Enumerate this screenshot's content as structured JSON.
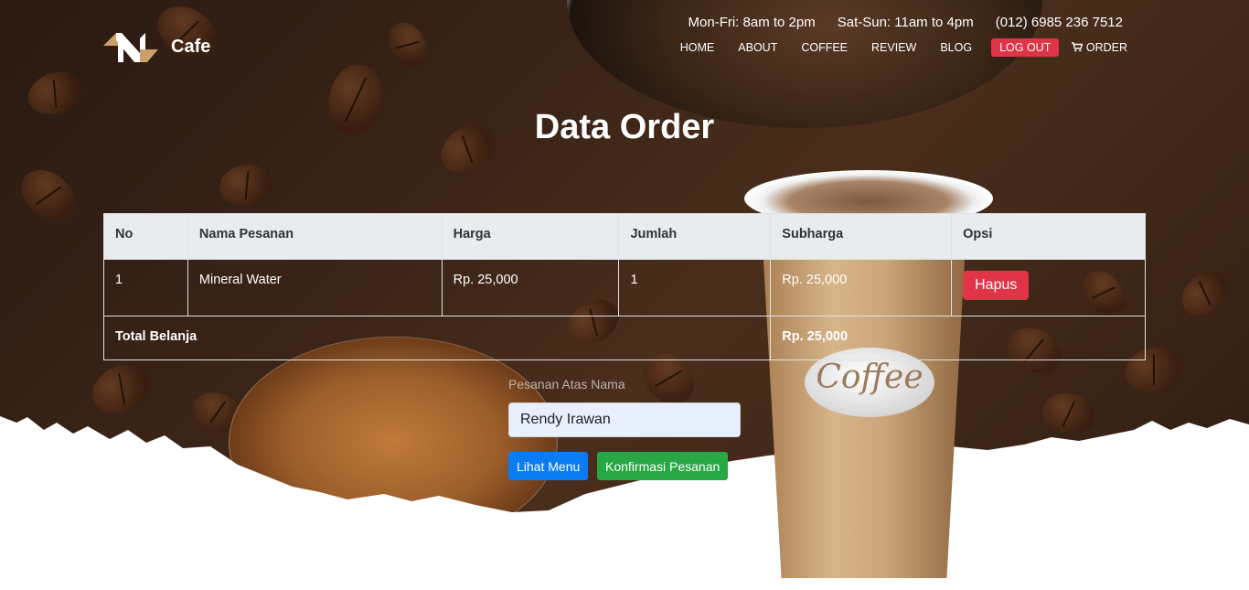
{
  "brand": {
    "name": "Cafe"
  },
  "header": {
    "info": [
      "Mon-Fri: 8am to 2pm",
      "Sat-Sun: 11am to 4pm",
      "(012) 6985 236 7512"
    ],
    "nav": [
      "HOME",
      "ABOUT",
      "COFFEE",
      "REVIEW",
      "BLOG"
    ],
    "logout": "LOG OUT",
    "order": "ORDER"
  },
  "page": {
    "title": "Data Order"
  },
  "table": {
    "headers": [
      "No",
      "Nama Pesanan",
      "Harga",
      "Jumlah",
      "Subharga",
      "Opsi"
    ],
    "rows": [
      {
        "no": "1",
        "nama": "Mineral Water",
        "harga": "Rp. 25,000",
        "jumlah": "1",
        "subharga": "Rp. 25,000",
        "action": "Hapus"
      }
    ],
    "total_label": "Total Belanja",
    "total_value": "Rp. 25,000"
  },
  "form": {
    "label": "Pesanan Atas Nama",
    "name_value": "Rendy Irawan",
    "lihat_menu": "Lihat Menu",
    "konfirmasi": "Konfirmasi Pesanan"
  },
  "decoration": {
    "cup_label": "Coffee"
  },
  "colors": {
    "danger": "#e03546",
    "primary": "#0b7cf2",
    "success": "#28a745",
    "header_bg": "#e9ecef"
  },
  "icons": {
    "logo": "cafe-logo-icon",
    "cart": "cart-icon"
  }
}
